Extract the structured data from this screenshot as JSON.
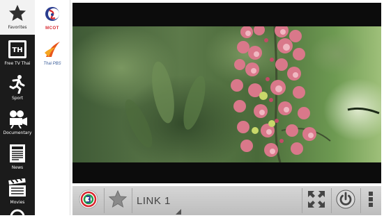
{
  "sidebar": {
    "items": [
      {
        "label": "Favorites",
        "icon": "star-icon"
      },
      {
        "label": "Free TV Thai",
        "icon": "tv-th-icon",
        "icon_text": "TH"
      },
      {
        "label": "Sport",
        "icon": "runner-icon"
      },
      {
        "label": "Documentary",
        "icon": "movie-camera-icon"
      },
      {
        "label": "News",
        "icon": "newspaper-icon"
      },
      {
        "label": "Movies",
        "icon": "clapperboard-icon"
      }
    ]
  },
  "channels": [
    {
      "logo_text": "MCOT",
      "icon": "mcot-logo"
    },
    {
      "logo_text": "Thai PBS",
      "icon": "thaipbs-logo"
    }
  ],
  "player": {
    "link_label": "LINK 1"
  },
  "colors": {
    "sidebar_bg": "#1b1b1b",
    "controls_bg": "#c9c9c9",
    "channel3_red": "#d7262e",
    "mcot_blue": "#2a3d8f",
    "thaipbs_orange": "#e8561c"
  }
}
